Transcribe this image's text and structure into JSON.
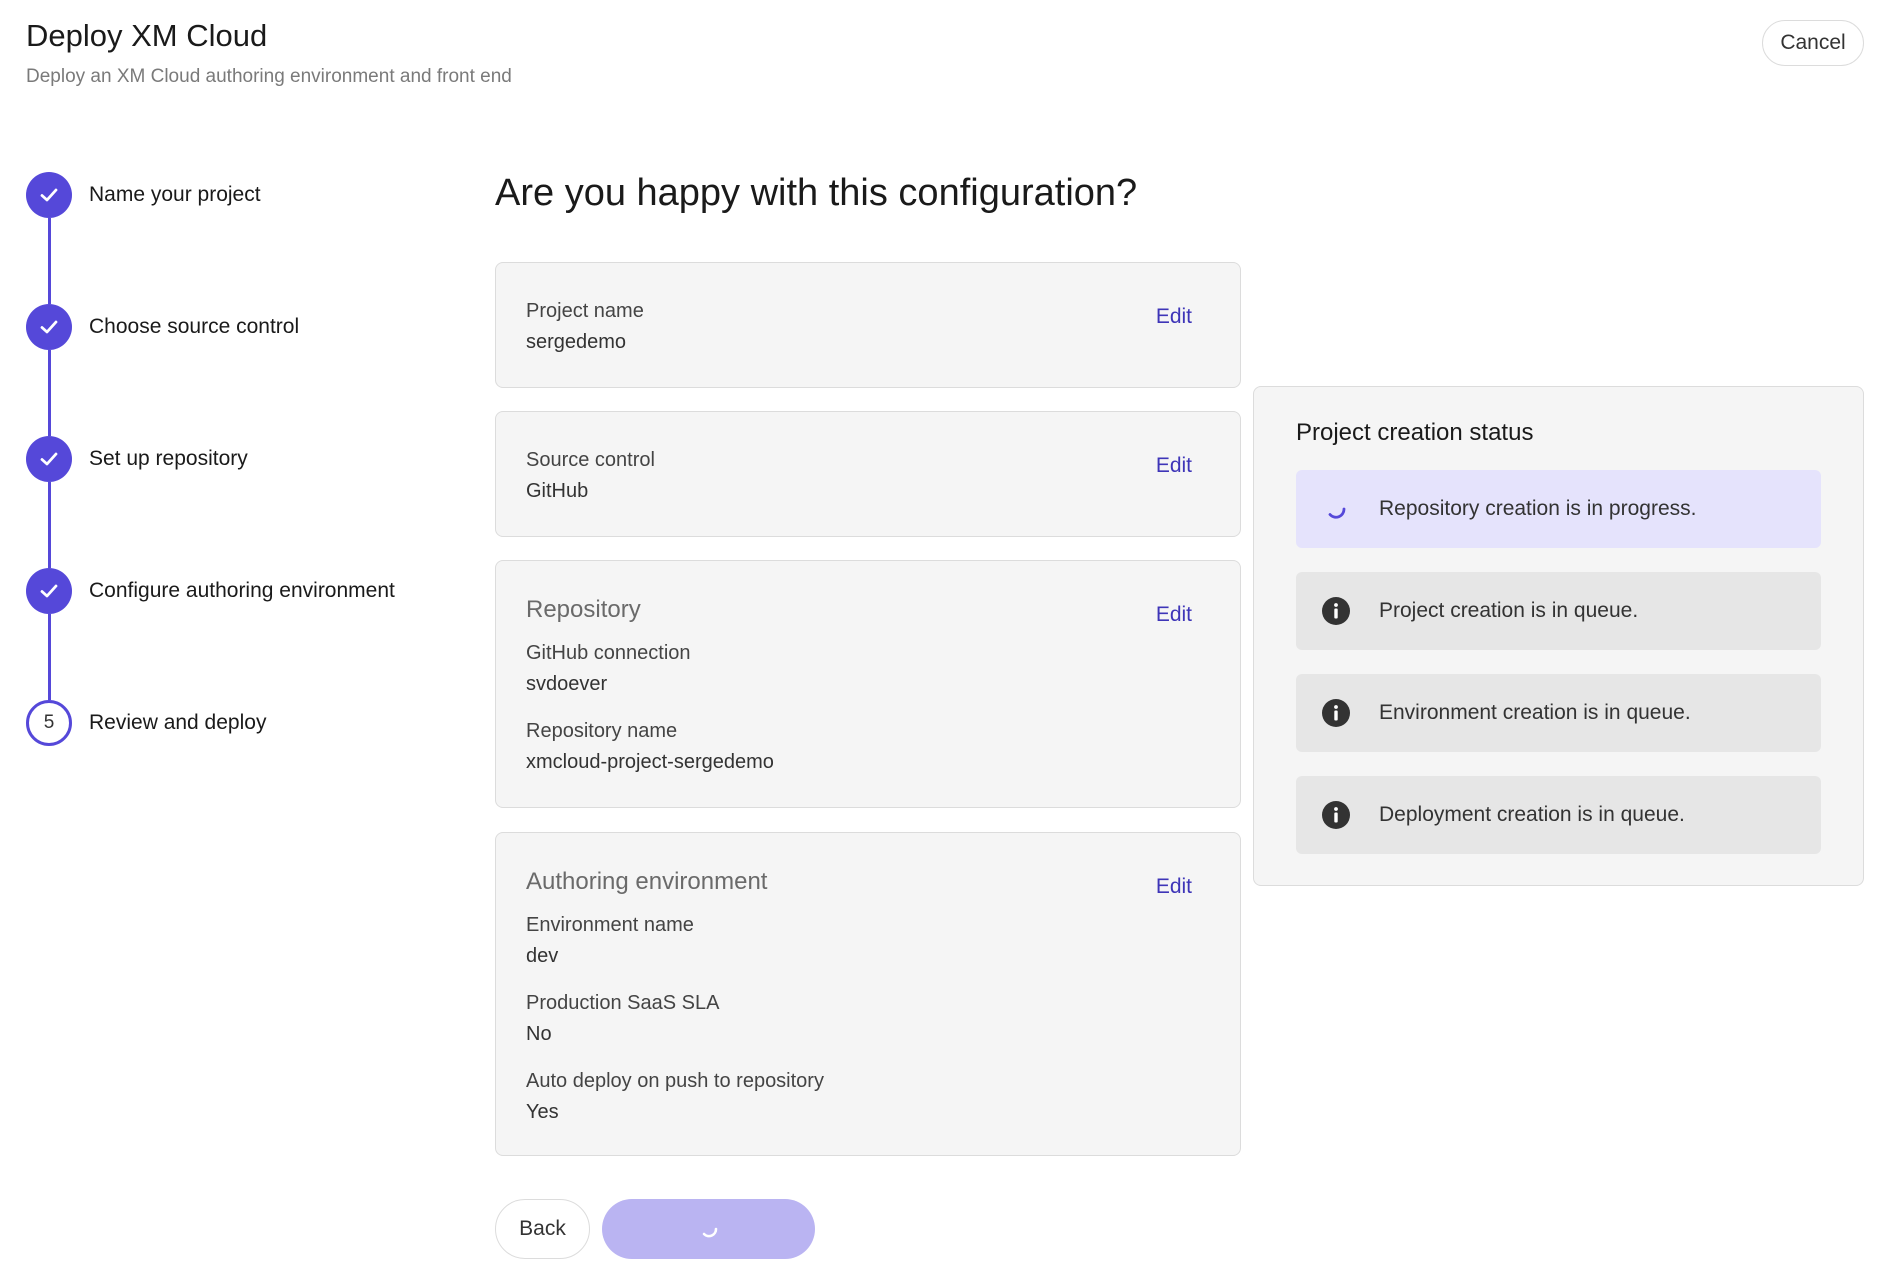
{
  "header": {
    "title": "Deploy XM Cloud",
    "subtitle": "Deploy an XM Cloud authoring environment and front end",
    "cancel_label": "Cancel"
  },
  "stepper": {
    "steps": [
      {
        "label": "Name your project",
        "state": "done"
      },
      {
        "label": "Choose source control",
        "state": "done"
      },
      {
        "label": "Set up repository",
        "state": "done"
      },
      {
        "label": "Configure authoring environment",
        "state": "done"
      },
      {
        "label": "Review and deploy",
        "state": "current",
        "number": "5"
      }
    ]
  },
  "main": {
    "title": "Are you happy with this configuration?",
    "edit_label": "Edit",
    "project": {
      "label": "Project name",
      "value": "sergedemo"
    },
    "source_control": {
      "label": "Source control",
      "value": "GitHub"
    },
    "repository": {
      "title": "Repository",
      "github_connection": {
        "label": "GitHub connection",
        "value": "svdoever"
      },
      "repository_name": {
        "label": "Repository name",
        "value": "xmcloud-project-sergedemo"
      }
    },
    "authoring": {
      "title": "Authoring environment",
      "environment_name": {
        "label": "Environment name",
        "value": "dev"
      },
      "saas_sla": {
        "label": "Production SaaS SLA",
        "value": "No"
      },
      "auto_deploy": {
        "label": "Auto deploy on push to repository",
        "value": "Yes"
      }
    },
    "back_label": "Back"
  },
  "status": {
    "title": "Project creation status",
    "items": [
      {
        "text": "Repository creation is in progress.",
        "state": "in-progress",
        "icon": "spinner-icon"
      },
      {
        "text": "Project creation is in queue.",
        "state": "queued",
        "icon": "info-icon"
      },
      {
        "text": "Environment creation is in queue.",
        "state": "queued",
        "icon": "info-icon"
      },
      {
        "text": "Deployment creation is in queue.",
        "state": "queued",
        "icon": "info-icon"
      }
    ]
  },
  "colors": {
    "accent": "#5548d9",
    "link": "#3e35b8",
    "deploy_button_disabled": "#bab4f2",
    "active_status_bg": "#e5e3fc",
    "queued_status_bg": "#e6e6e6"
  }
}
